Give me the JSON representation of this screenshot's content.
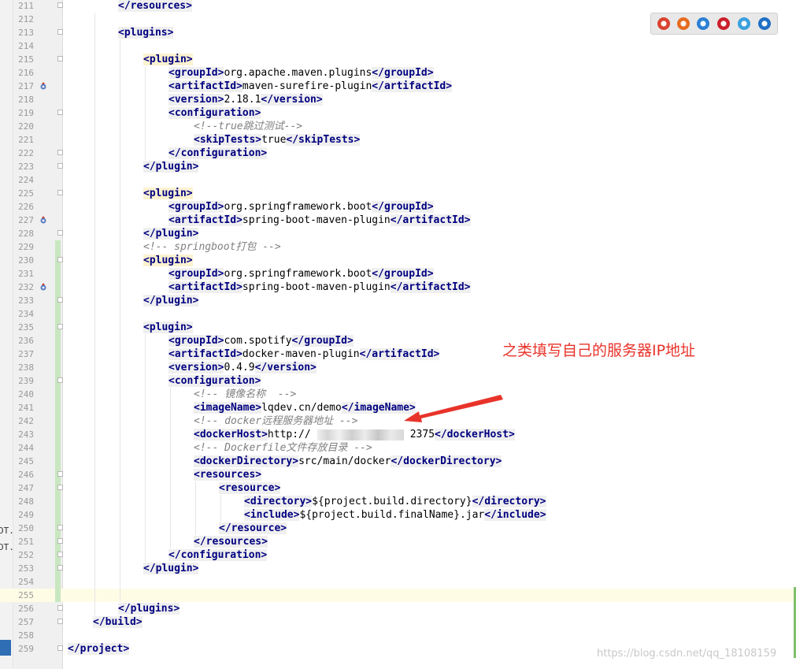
{
  "left_strip_labels": [
    "DT.j",
    "DT.j"
  ],
  "browser_icons": [
    {
      "name": "chrome-icon",
      "color": "#d9432f"
    },
    {
      "name": "firefox-icon",
      "color": "#e66b1f"
    },
    {
      "name": "safari-icon",
      "color": "#2a7fd4"
    },
    {
      "name": "opera-icon",
      "color": "#cc1f2b"
    },
    {
      "name": "ie-icon",
      "color": "#3aa0dd"
    },
    {
      "name": "edge-icon",
      "color": "#1f6fc4"
    }
  ],
  "annotation": "之类填写自己的服务器IP地址",
  "watermark": "https://blog.csdn.net/qq_18108159",
  "editor": {
    "lines": [
      {
        "n": "211",
        "i": 2,
        "p": [
          [
            "t",
            "</resources>"
          ]
        ]
      },
      {
        "n": "212",
        "i": 0,
        "p": []
      },
      {
        "n": "213",
        "i": 2,
        "p": [
          [
            "t",
            "<plugins>"
          ]
        ]
      },
      {
        "n": "214",
        "i": 0,
        "p": []
      },
      {
        "n": "215",
        "i": 3,
        "p": [
          [
            "h",
            "<plugin>"
          ]
        ]
      },
      {
        "n": "216",
        "i": 4,
        "p": [
          [
            "t",
            "<groupId>"
          ],
          [
            "x",
            "org.apache.maven.plugins"
          ],
          [
            "t",
            "</groupId>"
          ]
        ]
      },
      {
        "n": "217",
        "i": 4,
        "p": [
          [
            "t",
            "<artifactId>"
          ],
          [
            "x",
            "maven-surefire-plugin"
          ],
          [
            "t",
            "</artifactId>"
          ]
        ]
      },
      {
        "n": "218",
        "i": 4,
        "p": [
          [
            "t",
            "<version>"
          ],
          [
            "x",
            "2.18.1"
          ],
          [
            "t",
            "</version>"
          ]
        ]
      },
      {
        "n": "219",
        "i": 4,
        "p": [
          [
            "t",
            "<configuration>"
          ]
        ]
      },
      {
        "n": "220",
        "i": 5,
        "p": [
          [
            "c",
            "<!--true跳过测试-->"
          ]
        ]
      },
      {
        "n": "221",
        "i": 5,
        "p": [
          [
            "t",
            "<skipTests>"
          ],
          [
            "x",
            "true"
          ],
          [
            "t",
            "</skipTests>"
          ]
        ]
      },
      {
        "n": "222",
        "i": 4,
        "p": [
          [
            "t",
            "</configuration>"
          ]
        ]
      },
      {
        "n": "223",
        "i": 3,
        "p": [
          [
            "t",
            "</plugin>"
          ]
        ]
      },
      {
        "n": "224",
        "i": 0,
        "p": []
      },
      {
        "n": "225",
        "i": 3,
        "p": [
          [
            "h",
            "<plugin>"
          ]
        ]
      },
      {
        "n": "226",
        "i": 4,
        "p": [
          [
            "t",
            "<groupId>"
          ],
          [
            "x",
            "org.springframework.boot"
          ],
          [
            "t",
            "</groupId>"
          ]
        ]
      },
      {
        "n": "227",
        "i": 4,
        "p": [
          [
            "t",
            "<artifactId>"
          ],
          [
            "x",
            "spring-boot-maven-plugin"
          ],
          [
            "t",
            "</artifactId>"
          ]
        ]
      },
      {
        "n": "228",
        "i": 3,
        "p": [
          [
            "t",
            "</plugin>"
          ]
        ]
      },
      {
        "n": "229",
        "i": 3,
        "p": [
          [
            "c",
            "<!-- springboot打包 -->"
          ]
        ]
      },
      {
        "n": "230",
        "i": 3,
        "p": [
          [
            "h",
            "<plugin>"
          ]
        ]
      },
      {
        "n": "231",
        "i": 4,
        "p": [
          [
            "t",
            "<groupId>"
          ],
          [
            "x",
            "org.springframework.boot"
          ],
          [
            "t",
            "</groupId>"
          ]
        ]
      },
      {
        "n": "232",
        "i": 4,
        "p": [
          [
            "t",
            "<artifactId>"
          ],
          [
            "x",
            "spring-boot-maven-plugin"
          ],
          [
            "t",
            "</artifactId>"
          ]
        ]
      },
      {
        "n": "233",
        "i": 3,
        "p": [
          [
            "t",
            "</plugin>"
          ]
        ]
      },
      {
        "n": "234",
        "i": 0,
        "p": []
      },
      {
        "n": "235",
        "i": 3,
        "p": [
          [
            "t",
            "<plugin>"
          ]
        ]
      },
      {
        "n": "236",
        "i": 4,
        "p": [
          [
            "t",
            "<groupId>"
          ],
          [
            "x",
            "com.spotify"
          ],
          [
            "t",
            "</groupId>"
          ]
        ]
      },
      {
        "n": "237",
        "i": 4,
        "p": [
          [
            "t",
            "<artifactId>"
          ],
          [
            "x",
            "docker-maven-plugin"
          ],
          [
            "t",
            "</artifactId>"
          ]
        ]
      },
      {
        "n": "238",
        "i": 4,
        "p": [
          [
            "t",
            "<version>"
          ],
          [
            "x",
            "0.4.9"
          ],
          [
            "t",
            "</version>"
          ]
        ]
      },
      {
        "n": "239",
        "i": 4,
        "p": [
          [
            "t",
            "<configuration>"
          ]
        ]
      },
      {
        "n": "240",
        "i": 5,
        "p": [
          [
            "c",
            "<!-- 镜像名称  -->"
          ]
        ]
      },
      {
        "n": "241",
        "i": 5,
        "p": [
          [
            "t",
            "<imageName>"
          ],
          [
            "x",
            "lqdev.cn/demo"
          ],
          [
            "t",
            "</imageName>"
          ]
        ]
      },
      {
        "n": "242",
        "i": 5,
        "p": [
          [
            "c",
            "<!-- docker远程服务器地址 -->"
          ]
        ]
      },
      {
        "n": "243",
        "i": 5,
        "p": [
          [
            "t",
            "<dockerHost>"
          ],
          [
            "x",
            "http://"
          ],
          [
            "b",
            ""
          ],
          [
            "x",
            "2375"
          ],
          [
            "t",
            "</dockerHost>"
          ]
        ]
      },
      {
        "n": "244",
        "i": 5,
        "p": [
          [
            "c",
            "<!-- Dockerfile文件存放目录 -->"
          ]
        ]
      },
      {
        "n": "245",
        "i": 5,
        "p": [
          [
            "t",
            "<dockerDirectory>"
          ],
          [
            "x",
            "src/main/docker"
          ],
          [
            "t",
            "</dockerDirectory>"
          ]
        ]
      },
      {
        "n": "246",
        "i": 5,
        "p": [
          [
            "t",
            "<resources>"
          ]
        ]
      },
      {
        "n": "247",
        "i": 6,
        "p": [
          [
            "t",
            "<resource>"
          ]
        ]
      },
      {
        "n": "248",
        "i": 7,
        "p": [
          [
            "t",
            "<directory>"
          ],
          [
            "x",
            "${project.build.directory}"
          ],
          [
            "t",
            "</directory>"
          ]
        ]
      },
      {
        "n": "249",
        "i": 7,
        "p": [
          [
            "t",
            "<include>"
          ],
          [
            "x",
            "${project.build.finalName}.jar"
          ],
          [
            "t",
            "</include>"
          ]
        ]
      },
      {
        "n": "250",
        "i": 6,
        "p": [
          [
            "t",
            "</resource>"
          ]
        ]
      },
      {
        "n": "251",
        "i": 5,
        "p": [
          [
            "t",
            "</resources>"
          ]
        ]
      },
      {
        "n": "252",
        "i": 4,
        "p": [
          [
            "t",
            "</configuration>"
          ]
        ]
      },
      {
        "n": "253",
        "i": 3,
        "p": [
          [
            "t",
            "</plugin>"
          ]
        ]
      },
      {
        "n": "254",
        "i": 0,
        "p": []
      },
      {
        "n": "255",
        "i": 0,
        "p": []
      },
      {
        "n": "256",
        "i": 2,
        "p": [
          [
            "t",
            "</plugins>"
          ]
        ]
      },
      {
        "n": "257",
        "i": 1,
        "p": [
          [
            "t",
            "</build>"
          ]
        ]
      },
      {
        "n": "258",
        "i": 0,
        "p": []
      },
      {
        "n": "259",
        "i": 0,
        "p": [
          [
            "t",
            "</project>"
          ]
        ]
      }
    ]
  }
}
